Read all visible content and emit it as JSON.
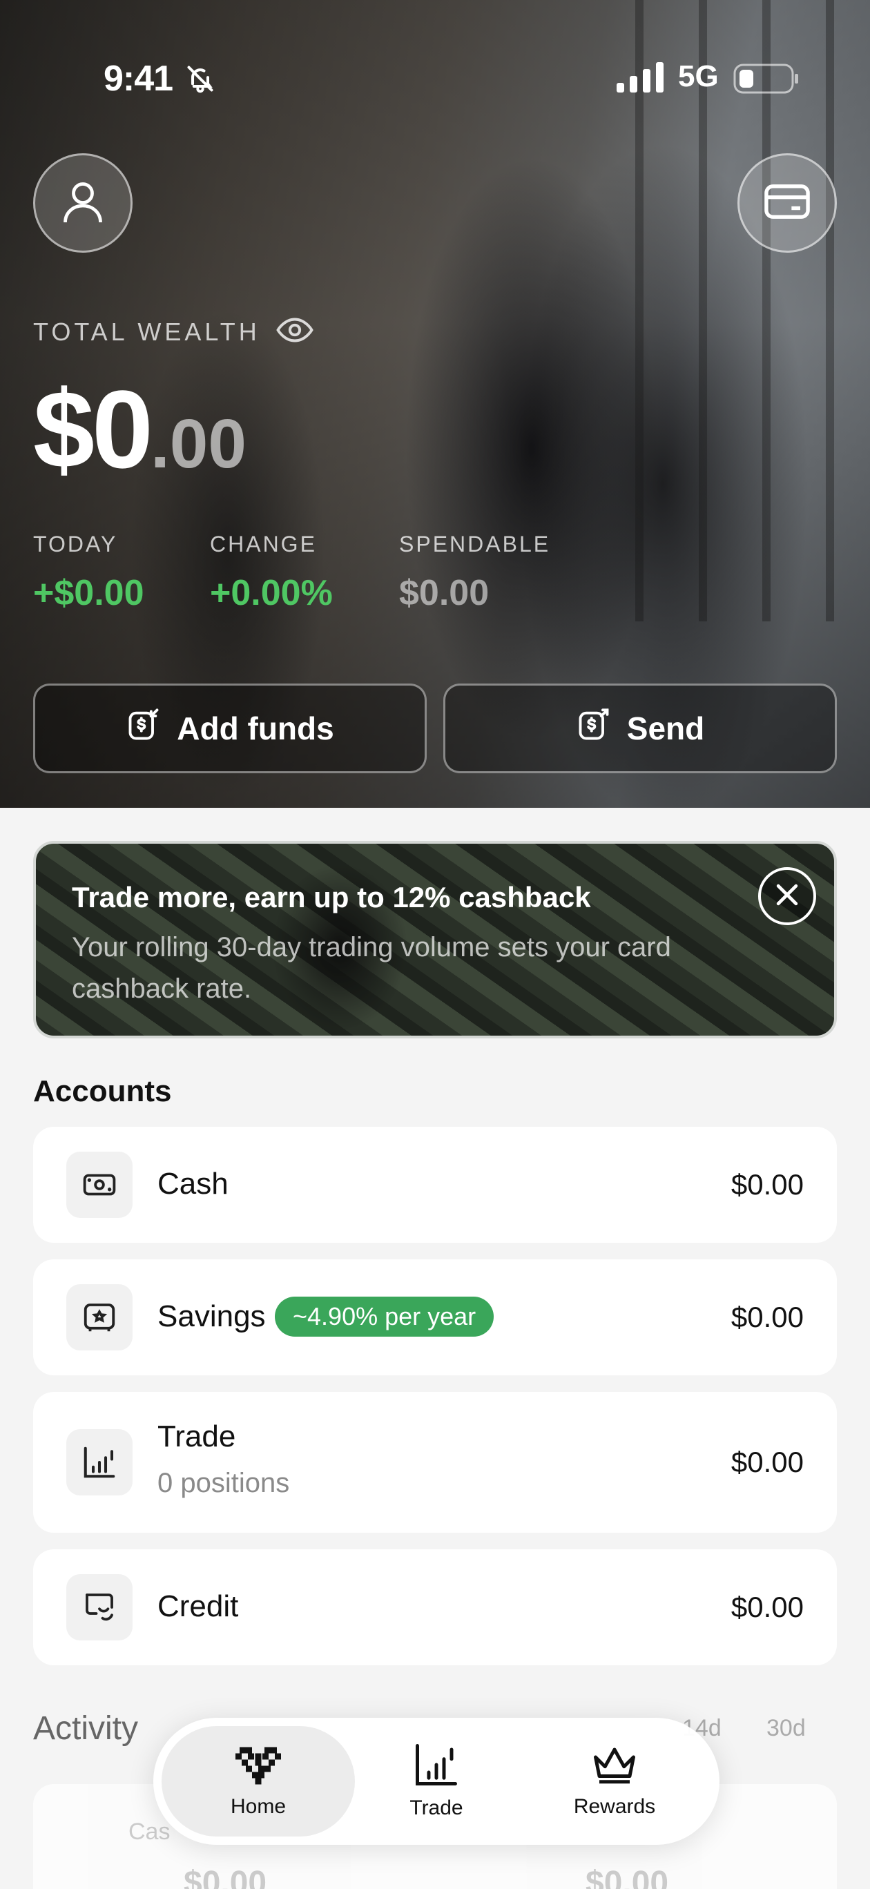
{
  "status": {
    "time": "9:41",
    "network": "5G"
  },
  "hero": {
    "total_label": "TOTAL WEALTH",
    "amount_main": "$0",
    "amount_cents": ".00",
    "stats": [
      {
        "label": "TODAY",
        "value": "+$0.00"
      },
      {
        "label": "CHANGE",
        "value": "+0.00%"
      },
      {
        "label": "SPENDABLE",
        "value": "$0.00"
      }
    ],
    "add_funds_label": "Add funds",
    "send_label": "Send"
  },
  "promo": {
    "title": "Trade more, earn up to 12% cashback",
    "description": "Your rolling 30-day trading volume sets your card cashback rate."
  },
  "accounts": {
    "heading": "Accounts",
    "items": [
      {
        "name": "Cash",
        "value": "$0.00",
        "icon": "cash-icon"
      },
      {
        "name": "Savings",
        "badge": "~4.90% per year",
        "value": "$0.00",
        "icon": "safe-icon"
      },
      {
        "name": "Trade",
        "sub": "0 positions",
        "value": "$0.00",
        "icon": "chart-icon"
      },
      {
        "name": "Credit",
        "value": "$0.00",
        "icon": "credit-icon"
      }
    ]
  },
  "activity": {
    "heading": "Activity",
    "ranges": [
      "14d",
      "30d"
    ],
    "card": {
      "left_label": "Cas",
      "left_value": "$0.00",
      "right_value": "$0.00"
    }
  },
  "tabs": [
    {
      "label": "Home",
      "icon": "heart-pixel-icon",
      "active": true
    },
    {
      "label": "Trade",
      "icon": "chart-icon"
    },
    {
      "label": "Rewards",
      "icon": "crown-icon"
    }
  ],
  "colors": {
    "positive": "#4fc763",
    "badge": "#3aa65a"
  }
}
